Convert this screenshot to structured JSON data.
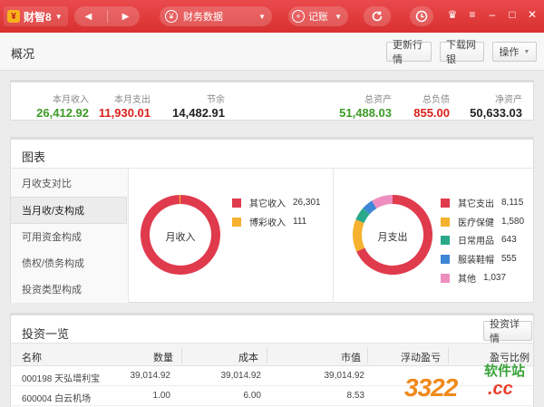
{
  "app": {
    "name": "财智8"
  },
  "toolbar": {
    "finance_label": "财务数据",
    "record_label": "记账"
  },
  "overview": {
    "title": "概况",
    "update_button": "更新行情",
    "download_button": "下载网银",
    "ops_button": "操作"
  },
  "stats": {
    "month_income": {
      "label": "本月收入",
      "value": "26,412.92"
    },
    "month_expense": {
      "label": "本月支出",
      "value": "11,930.01"
    },
    "balance": {
      "label": "节余",
      "value": "14,482.91"
    },
    "total_assets": {
      "label": "总资产",
      "value": "51,488.03"
    },
    "total_debt": {
      "label": "总负债",
      "value": "855.00"
    },
    "net_assets": {
      "label": "净资产",
      "value": "50,633.03"
    }
  },
  "charts": {
    "title": "图表",
    "side_items": [
      "月收支对比",
      "当月收/支构成",
      "可用资金构成",
      "债权/债务构成",
      "投资类型构成"
    ],
    "active_index": 1
  },
  "chart_data": [
    {
      "type": "pie",
      "title": "月收入",
      "categories": [
        "其它收入",
        "博彩收入"
      ],
      "values": [
        26301,
        111
      ],
      "colors": [
        "#e03a4d",
        "#f5b22e"
      ]
    },
    {
      "type": "pie",
      "title": "月支出",
      "categories": [
        "其它支出",
        "医疗保健",
        "日常用品",
        "服装鞋帽",
        "其他"
      ],
      "values": [
        8115,
        1580,
        643,
        555,
        1037
      ],
      "colors": [
        "#e03a4d",
        "#f5b22e",
        "#2aa98a",
        "#3e87d6",
        "#ee8ec0"
      ]
    }
  ],
  "investments": {
    "title": "投资一览",
    "detail_button": "投资详情",
    "columns": [
      "名称",
      "数量",
      "成本",
      "市值",
      "浮动盈亏",
      "盈亏比例"
    ],
    "rows": [
      {
        "name": "000198 天弘增利宝",
        "qty": "39,014.92",
        "cost": "39,014.92",
        "value": "39,014.92"
      },
      {
        "name": "600004 白云机场",
        "qty": "1.00",
        "cost": "6.00",
        "value": "8.53"
      }
    ]
  },
  "watermark": {
    "number": "3322",
    "site_cn": "软件站",
    "site_tld": ".cc"
  }
}
